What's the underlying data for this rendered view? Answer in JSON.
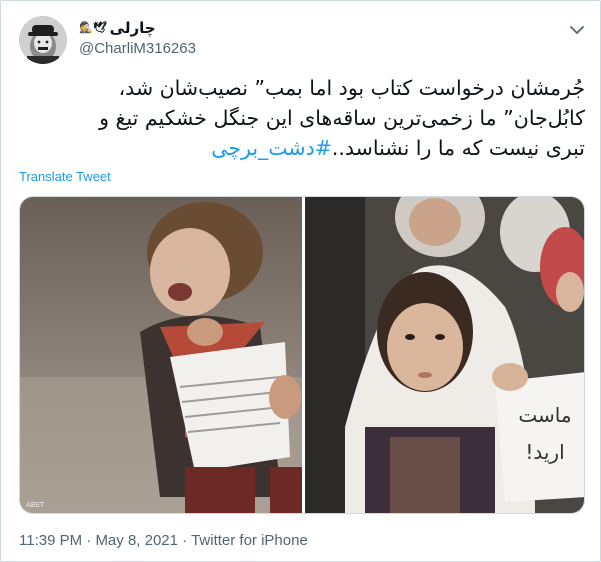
{
  "tweet": {
    "display_name": "چارلی",
    "display_name_emoji": "🕵️🕊",
    "handle": "@CharliM316263",
    "text_lines": [
      "جُرمشان درخواست کتاب بود اما بمب” نصیب‌شان شد،",
      "کابُل‌جان” ما زخمی‌ترین ساقه‌های این جنگل خشکیم تیغ و",
      "تبری نیست که ما را نشناسد.."
    ],
    "hashtag": "#دشت_برچی",
    "translate_label": "Translate Tweet",
    "time": "11:39 PM",
    "date": "May 8, 2021",
    "source": "Twitter for iPhone",
    "separator": "·"
  },
  "media": {
    "left_photo": {
      "sign_text": ""
    },
    "right_photo": {
      "sign_line1": "ماست",
      "sign_line2": "اريد!"
    }
  },
  "colors": {
    "link": "#1d9bf0",
    "secondary_text": "#536471",
    "primary_text": "#0f1419",
    "border": "#cfd9de"
  }
}
